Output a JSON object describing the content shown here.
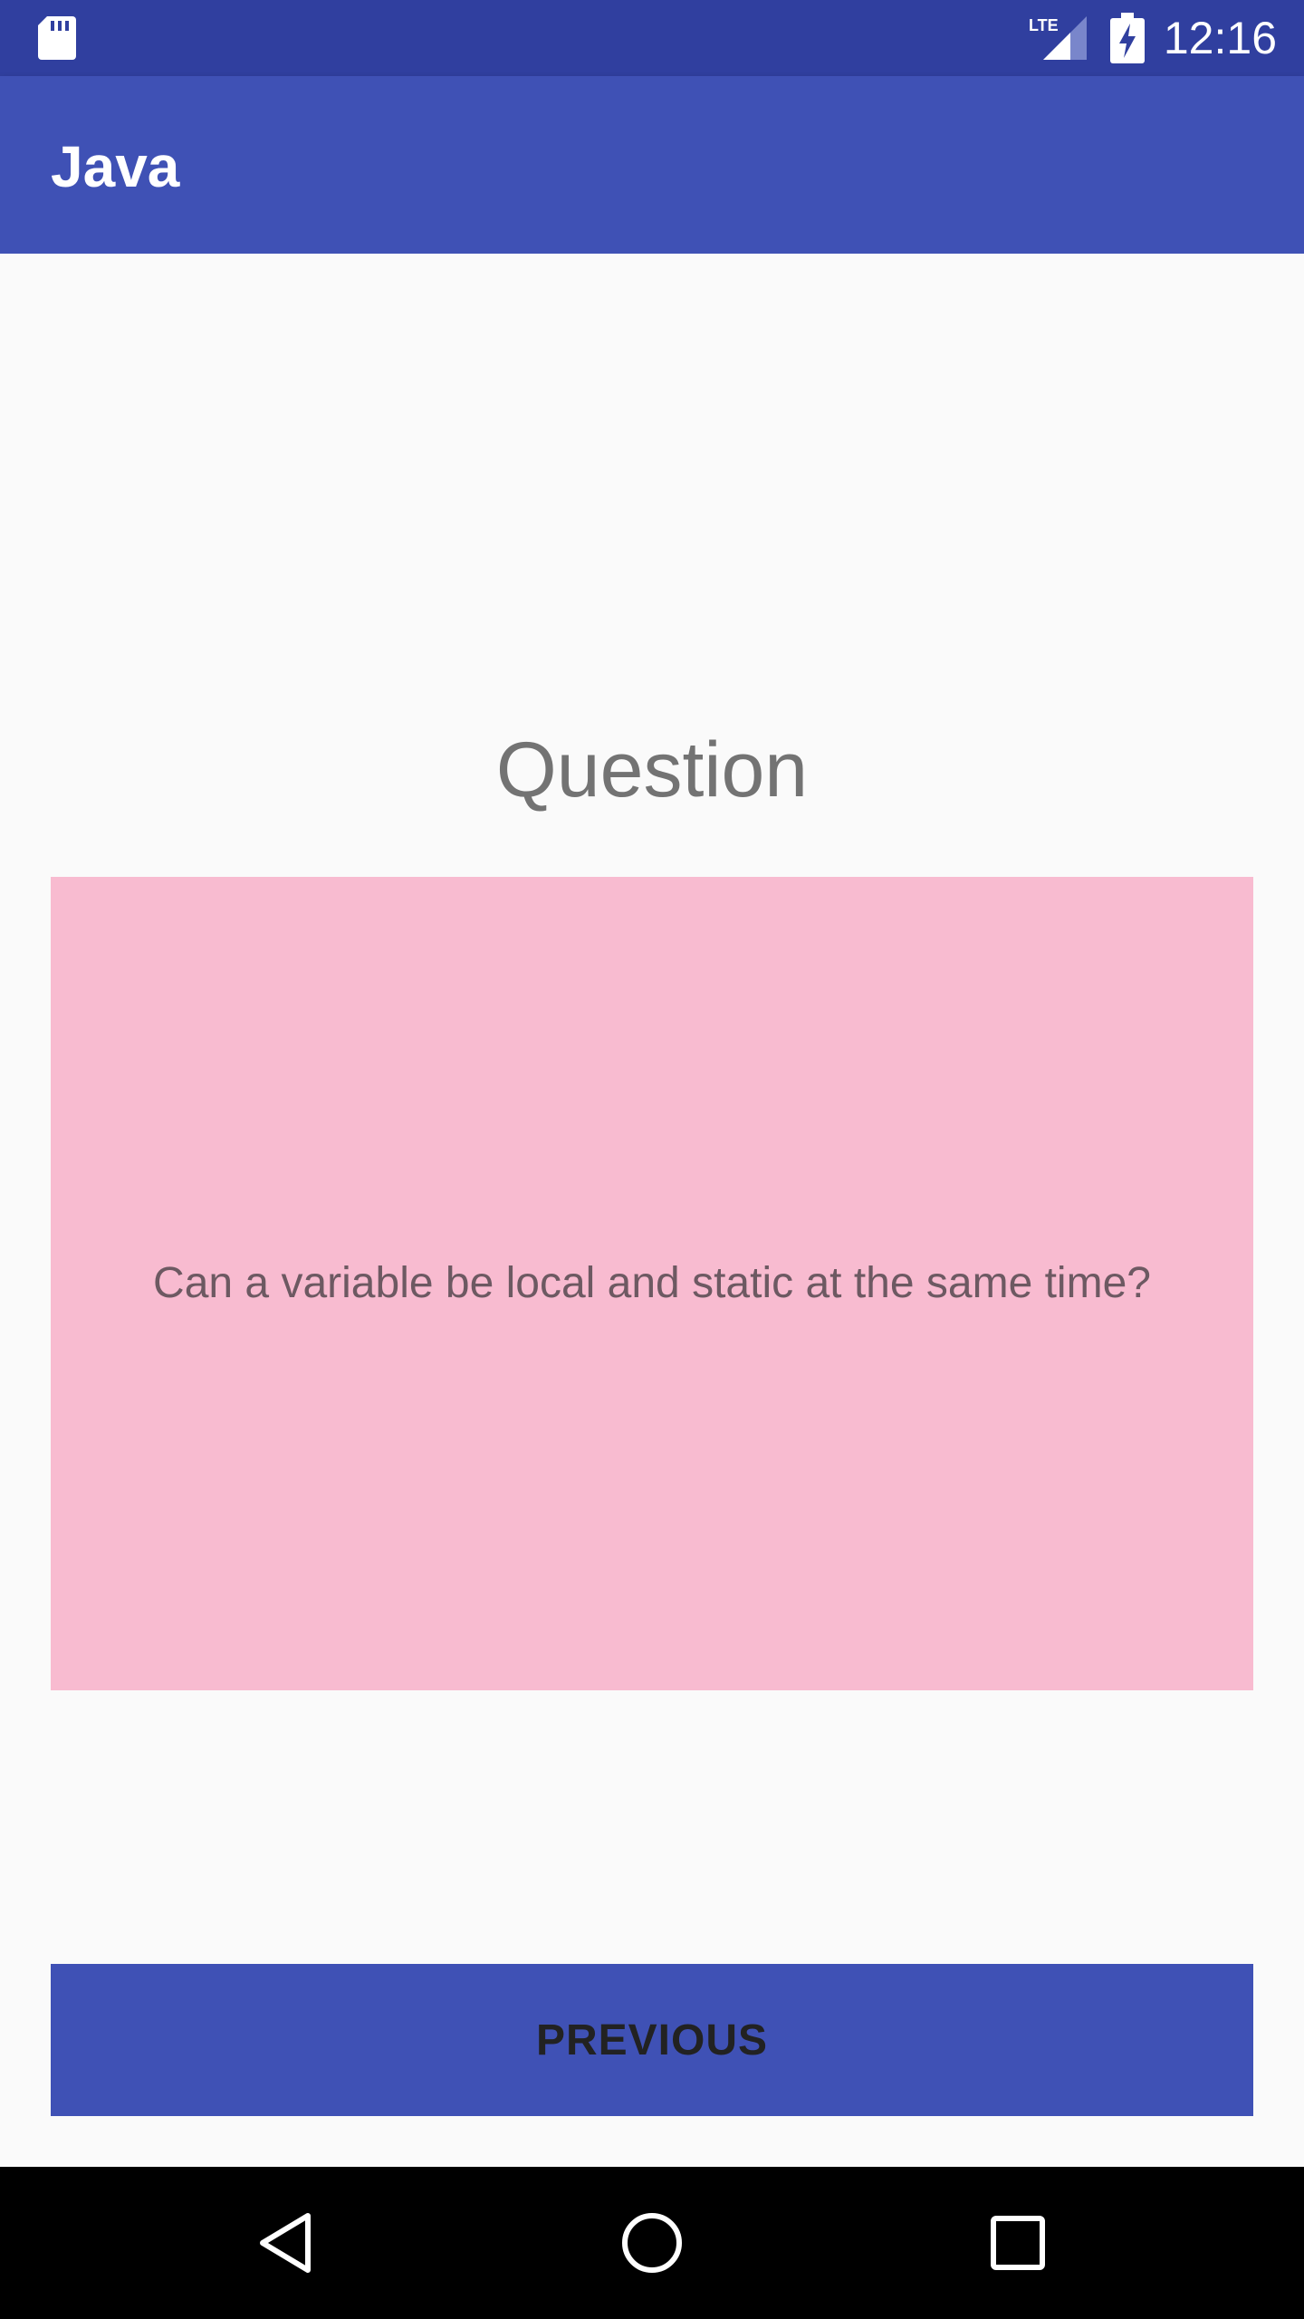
{
  "status_bar": {
    "time": "12:16",
    "network_label": "LTE",
    "icons": [
      "sd-card-icon",
      "lte-signal-icon",
      "battery-charging-icon"
    ],
    "background_color": "#303f9f"
  },
  "app_bar": {
    "title": "Java",
    "background_color": "#3f51b5"
  },
  "main": {
    "heading": "Question",
    "question_text": "Can a variable be local and static at the same time?",
    "card_color": "#f8bbd0",
    "previous_button_label": "PREVIOUS",
    "button_color": "#3f51b5"
  },
  "nav_bar": {
    "icons": [
      "back-icon",
      "home-icon",
      "recents-icon"
    ]
  }
}
